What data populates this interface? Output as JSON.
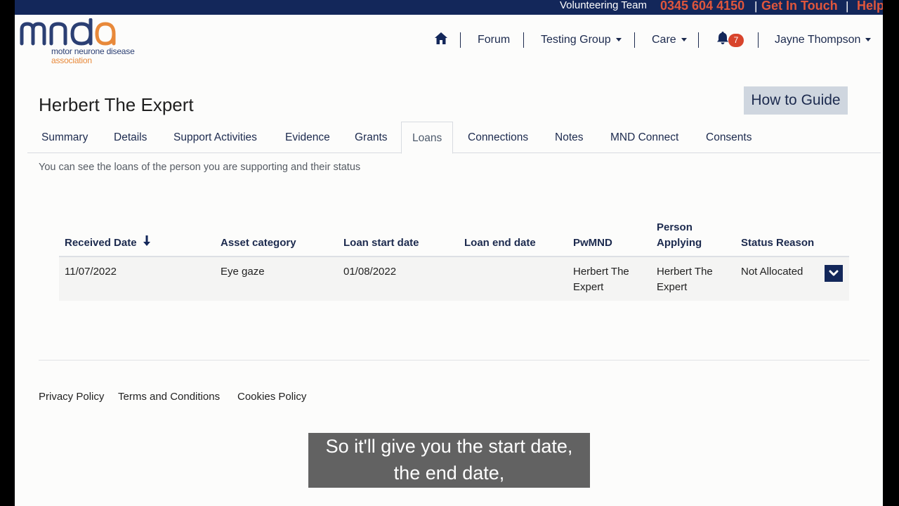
{
  "topbar": {
    "team_label": "Volunteering Team",
    "phone": "0345 604 4150",
    "get_in_touch": "Get In Touch",
    "help": "Help",
    "separator": "|"
  },
  "logo": {
    "wordmark": "mnda",
    "line1": "motor neurone disease",
    "line2": "association"
  },
  "nav": {
    "forum": "Forum",
    "testing_group": "Testing Group",
    "care": "Care",
    "notification_count": "7",
    "user": "Jayne Thompson"
  },
  "page": {
    "title": "Herbert The Expert",
    "guide_button": "How to Guide",
    "intro": "You can see the loans of the person you are supporting and their status"
  },
  "tabs": [
    {
      "label": "Summary"
    },
    {
      "label": "Details"
    },
    {
      "label": "Support Activities"
    },
    {
      "label": "Evidence"
    },
    {
      "label": "Grants"
    },
    {
      "label": "Loans"
    },
    {
      "label": "Connections"
    },
    {
      "label": "Notes"
    },
    {
      "label": "MND Connect"
    },
    {
      "label": "Consents"
    }
  ],
  "active_tab": "Loans",
  "table": {
    "headers": {
      "received": "Received Date",
      "asset": "Asset category",
      "start": "Loan start date",
      "end": "Loan end date",
      "pwmnd": "PwMND",
      "applying_1": "Person",
      "applying_2": "Applying",
      "status": "Status Reason"
    },
    "rows": [
      {
        "received": "11/07/2022",
        "asset": "Eye gaze",
        "start": "01/08/2022",
        "end": "",
        "pwmnd_1": "Herbert The",
        "pwmnd_2": "Expert",
        "applying_1": "Herbert The",
        "applying_2": "Expert",
        "status": "Not Allocated"
      }
    ]
  },
  "footer": {
    "privacy": "Privacy Policy",
    "terms": "Terms and Conditions",
    "cookies": "Cookies Policy"
  },
  "caption": {
    "line1": "So it'll give you the start date,",
    "line2": "the end date,"
  },
  "colors": {
    "navy": "#13275a",
    "accent_orange": "#e0563c",
    "badge_red": "#d8442c",
    "logo_orange": "#e8893a"
  }
}
